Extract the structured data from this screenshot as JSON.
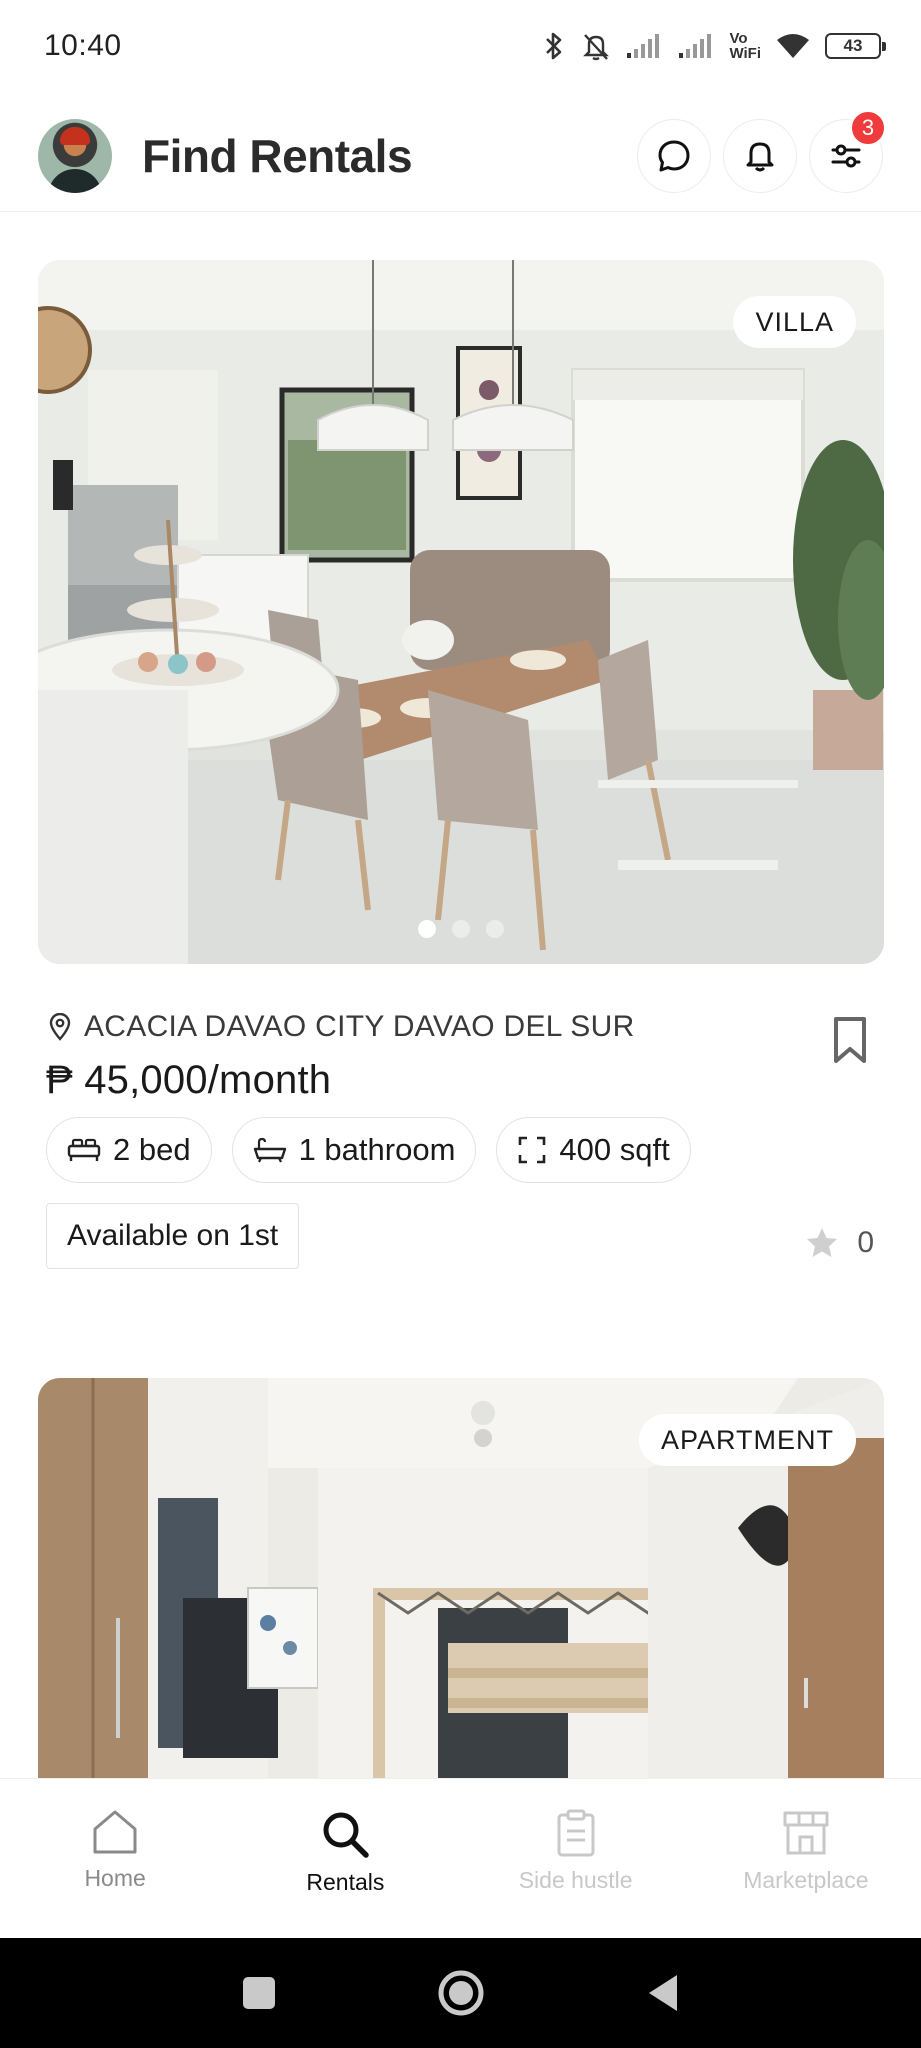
{
  "status_bar": {
    "time": "10:40",
    "network_label": "Vo\nWiFi",
    "battery": "43",
    "icons": [
      "bluetooth-icon",
      "mute-icon",
      "signal-icon",
      "signal-icon",
      "vowifi-icon",
      "wifi-icon",
      "battery-icon"
    ]
  },
  "header": {
    "title": "Find Rentals",
    "filter_badge": "3",
    "icons": [
      "chat-icon",
      "bell-icon",
      "filter-icon"
    ]
  },
  "listings": [
    {
      "type": "VILLA",
      "location": "ACACIA DAVAO CITY DAVAO DEL SUR",
      "price": "₱ 45,000/month",
      "beds": "2 bed",
      "baths": "1 bathroom",
      "area": "400 sqft",
      "availability": "Available on 1st",
      "rating": "0",
      "photo_count": 3,
      "active_photo": 1
    },
    {
      "type": "APARTMENT"
    }
  ],
  "bottom_nav": {
    "items": [
      {
        "label": "Home",
        "icon": "home-icon",
        "state": "default"
      },
      {
        "label": "Rentals",
        "icon": "search-icon",
        "state": "active"
      },
      {
        "label": "Side hustle",
        "icon": "clipboard-icon",
        "state": "muted"
      },
      {
        "label": "Marketplace",
        "icon": "store-icon",
        "state": "muted"
      }
    ]
  },
  "colors": {
    "badge": "#ef3b3b",
    "active_nav": "#111111",
    "muted_nav": "#c8c8c8",
    "border": "#e3e3e3"
  }
}
